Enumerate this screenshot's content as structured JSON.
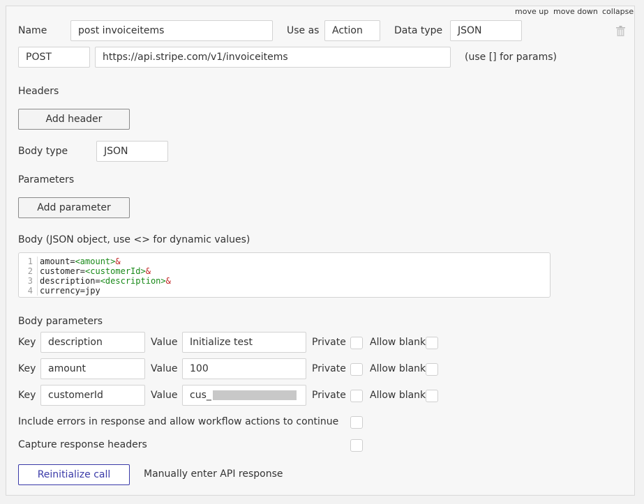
{
  "top_links": {
    "move_up": "move up",
    "move_down": "move down",
    "collapse": "collapse"
  },
  "call": {
    "name_label": "Name",
    "name_value": "post invoiceitems",
    "use_as_label": "Use as",
    "use_as_value": "Action",
    "data_type_label": "Data type",
    "data_type_value": "JSON",
    "method": "POST",
    "url": "https://api.stripe.com/v1/invoiceitems",
    "url_hint": "(use [] for params)"
  },
  "headers": {
    "title": "Headers",
    "add_button": "Add header"
  },
  "body_type": {
    "label": "Body type",
    "value": "JSON"
  },
  "parameters": {
    "title": "Parameters",
    "add_button": "Add parameter"
  },
  "body": {
    "label": "Body (JSON object, use <> for dynamic values)",
    "lines": [
      {
        "num": "1",
        "key": "amount=",
        "dyn": "<amount>",
        "amp": "&"
      },
      {
        "num": "2",
        "key": "customer=",
        "dyn": "<customerId>",
        "amp": "&"
      },
      {
        "num": "3",
        "key": "description=",
        "dyn": "<description>",
        "amp": "&"
      },
      {
        "num": "4",
        "key": "currency=jpy",
        "dyn": "",
        "amp": ""
      }
    ]
  },
  "body_parameters": {
    "title": "Body parameters",
    "key_label": "Key",
    "value_label": "Value",
    "private_label": "Private",
    "allow_blank_label": "Allow blank",
    "rows": [
      {
        "key": "description",
        "value": "Initialize test"
      },
      {
        "key": "amount",
        "value": "100"
      },
      {
        "key": "customerId",
        "value": "cus_"
      }
    ]
  },
  "options": {
    "include_errors": "Include errors in response and allow workflow actions to continue",
    "capture_headers": "Capture response headers"
  },
  "footer": {
    "reinitialize": "Reinitialize call",
    "manual": "Manually enter API response"
  },
  "colors": {
    "primary_button": "#3a3aa8",
    "dynamic_token": "#1a8a1a",
    "ampersand": "#c02020"
  },
  "icons": {
    "delete": "trash-icon"
  }
}
